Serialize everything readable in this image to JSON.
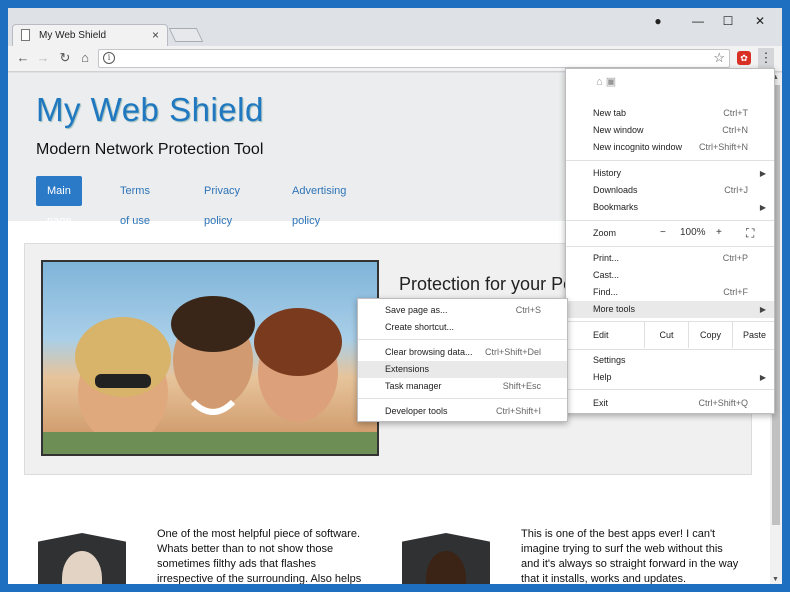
{
  "browser": {
    "tab_title": "My Web Shield",
    "tab_close": "×",
    "minimize": "—",
    "maximize": "☐",
    "close": "✕",
    "back": "←",
    "forward": "→",
    "reload": "↻",
    "home": "⌂",
    "info": "i",
    "star": "☆",
    "menu": "⋮",
    "profile": "●"
  },
  "site": {
    "brand": "My Web Shield",
    "subtitle": "Modern Network Protection Tool",
    "nav": [
      "Main page",
      "Terms of use",
      "Privacy policy",
      "Advertising policy"
    ],
    "feature_title": "Protection for your Pc",
    "review1": "One of the most helpful piece of software. Whats better than to not show those sometimes filthy ads that flashes irrespective of the surrounding. Also helps saving data",
    "review2": "This is one of the best apps ever! I can't imagine trying to surf the web without this and it's always so straight forward in the way that it installs, works and updates."
  },
  "menu": {
    "new_tab": "New tab",
    "new_tab_sc": "Ctrl+T",
    "new_window": "New window",
    "new_window_sc": "Ctrl+N",
    "incognito": "New incognito window",
    "incognito_sc": "Ctrl+Shift+N",
    "history": "History",
    "downloads": "Downloads",
    "downloads_sc": "Ctrl+J",
    "bookmarks": "Bookmarks",
    "zoom": "Zoom",
    "zoom_minus": "−",
    "zoom_value": "100%",
    "zoom_plus": "+",
    "fullscreen": "⛶",
    "print": "Print...",
    "print_sc": "Ctrl+P",
    "cast": "Cast...",
    "find": "Find...",
    "find_sc": "Ctrl+F",
    "more_tools": "More tools",
    "edit": "Edit",
    "cut": "Cut",
    "copy": "Copy",
    "paste": "Paste",
    "settings": "Settings",
    "help": "Help",
    "exit": "Exit",
    "exit_sc": "Ctrl+Shift+Q",
    "arrow": "▶"
  },
  "submenu": {
    "save_page": "Save page as...",
    "save_page_sc": "Ctrl+S",
    "create_shortcut": "Create shortcut...",
    "clear_browsing": "Clear browsing data...",
    "clear_browsing_sc": "Ctrl+Shift+Del",
    "extensions": "Extensions",
    "task_manager": "Task manager",
    "task_manager_sc": "Shift+Esc",
    "dev_tools": "Developer tools",
    "dev_tools_sc": "Ctrl+Shift+I"
  }
}
